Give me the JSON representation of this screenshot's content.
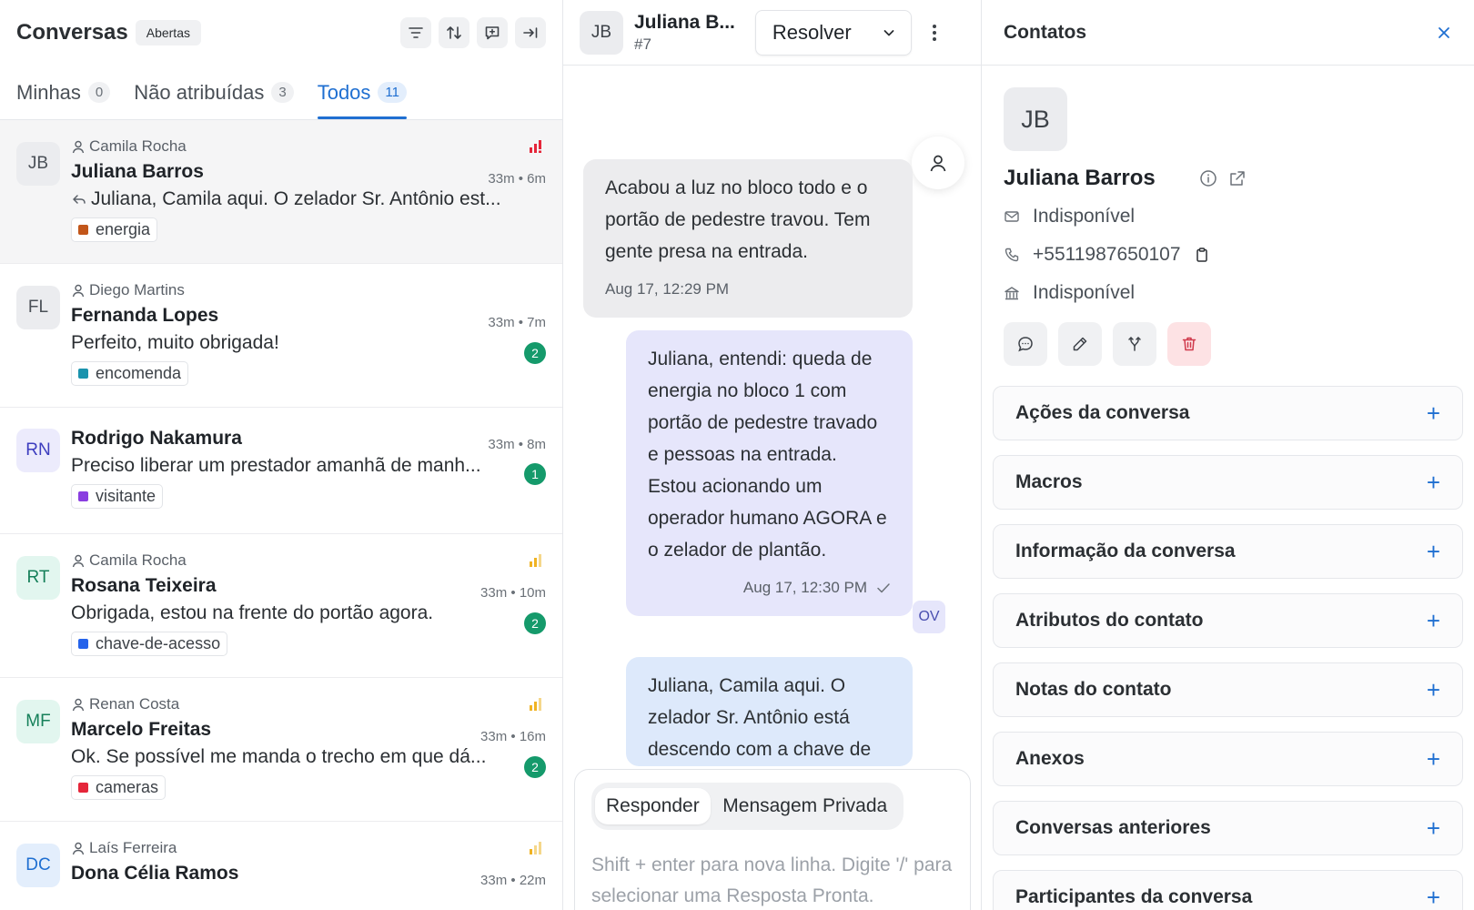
{
  "left": {
    "title": "Conversas",
    "status_filter": "Abertas",
    "tabs": [
      {
        "label": "Minhas",
        "count": "0"
      },
      {
        "label": "Não atribuídas",
        "count": "3"
      },
      {
        "label": "Todos",
        "count": "11"
      }
    ],
    "conversations": [
      {
        "initials": "JB",
        "assignee": "Camila Rocha",
        "name": "Juliana Barros",
        "time": "33m • 6m",
        "message": "Juliana, Camila aqui. O zelador Sr. Antônio est...",
        "label": "energia",
        "label_color": "#c2561a",
        "priority": "urgent",
        "unread": ""
      },
      {
        "initials": "FL",
        "assignee": "Diego Martins",
        "name": "Fernanda Lopes",
        "time": "33m • 7m",
        "message": "Perfeito, muito obrigada!",
        "label": "encomenda",
        "label_color": "#1a93ad",
        "priority": "",
        "unread": "2"
      },
      {
        "initials": "RN",
        "assignee": "",
        "name": "Rodrigo Nakamura",
        "time": "33m • 8m",
        "message": "Preciso liberar um prestador amanhã de manh...",
        "label": "visitante",
        "label_color": "#8a3ee0",
        "priority": "",
        "unread": "1"
      },
      {
        "initials": "RT",
        "assignee": "Camila Rocha",
        "name": "Rosana Teixeira",
        "time": "33m • 10m",
        "message": "Obrigada, estou na frente do portão agora.",
        "label": "chave-de-acesso",
        "label_color": "#2563eb",
        "priority": "medium",
        "unread": "2"
      },
      {
        "initials": "MF",
        "assignee": "Renan Costa",
        "name": "Marcelo Freitas",
        "time": "33m • 16m",
        "message": "Ok. Se possível me manda o trecho em que dá...",
        "label": "cameras",
        "label_color": "#e5263a",
        "priority": "medium",
        "unread": "2"
      },
      {
        "initials": "DC",
        "assignee": "Laís Ferreira",
        "name": "Dona Célia Ramos",
        "time": "33m • 22m",
        "message": "",
        "label": "",
        "label_color": "",
        "priority": "low",
        "unread": ""
      }
    ]
  },
  "middle": {
    "avatar_initials": "JB",
    "contact_name": "Juliana B...",
    "conversation_number": "#7",
    "resolve_label": "Resolver",
    "messages": [
      {
        "text": "Acabou a luz no bloco todo e o portão de pedestre travou. Tem gente presa na entrada.",
        "time": "Aug 17, 12:29 PM"
      },
      {
        "text": "Juliana, entendi: queda de energia no bloco 1 com portão de pedestre travado e pessoas na entrada. Estou acionando um operador humano AGORA e o zelador de plantão.",
        "time": "Aug 17, 12:30 PM",
        "sender_initials": "OV"
      },
      {
        "text": "Juliana, Camila aqui. O zelador Sr. Antônio está descendo com a chave de",
        "time": ""
      }
    ],
    "reply": {
      "mode_reply": "Responder",
      "mode_private": "Mensagem Privada",
      "placeholder": "Shift + enter para nova linha. Digite '/' para selecionar uma Resposta Pronta."
    }
  },
  "right": {
    "title": "Contatos",
    "avatar_initials": "JB",
    "name": "Juliana Barros",
    "email": "Indisponível",
    "phone": "+5511987650107",
    "company": "Indisponível",
    "accordions": [
      "Ações da conversa",
      "Macros",
      "Informação da conversa",
      "Atributos do contato",
      "Notas do contato",
      "Anexos",
      "Conversas anteriores",
      "Participantes da conversa"
    ]
  },
  "colors": {
    "accent": "#1f6fd1",
    "unread_badge": "#159a6b",
    "incoming_bubble": "#ececee",
    "bot_bubble": "#e6e6fb",
    "agent_bubble": "#dde9fb",
    "danger": "#d0394b"
  }
}
